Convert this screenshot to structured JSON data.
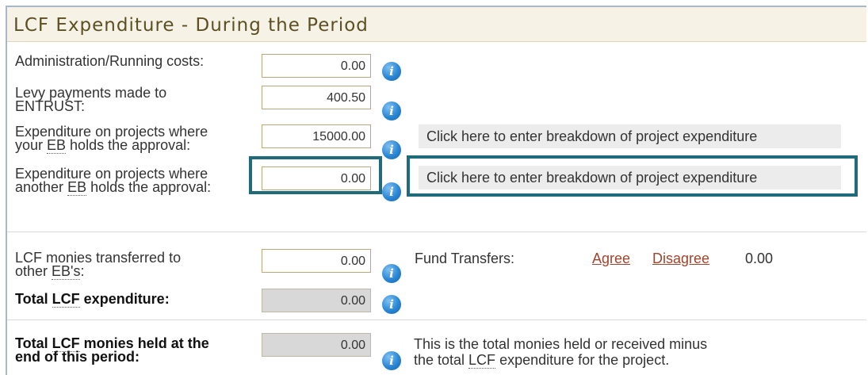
{
  "section": {
    "title": "LCF Expenditure - During the Period"
  },
  "rows": [
    {
      "label_1": "Administration/Running costs:",
      "value": "0.00"
    },
    {
      "label_1": "Levy payments made to",
      "label_2": "ENTRUST:",
      "value": "400.50"
    },
    {
      "label_1": "Expenditure on projects where",
      "label_2a": "your ",
      "label_2b": "EB",
      "label_2c": " holds the approval:",
      "value": "15000.00",
      "button": "Click here to enter breakdown of project expenditure"
    },
    {
      "label_1": "Expenditure on projects where",
      "label_2a": "another ",
      "label_2b": "EB",
      "label_2c": " holds the approval:",
      "value": "0.00",
      "button": "Click here to enter breakdown of project expenditure"
    },
    {
      "label_1": "LCF monies transferred to",
      "label_2a": "other ",
      "label_2b": "EB's",
      "label_2c": ":",
      "value": "0.00"
    },
    {
      "label_1a": "Total ",
      "label_1b": "LCF",
      "label_1c": " expenditure:",
      "value": "0.00"
    },
    {
      "label_1a": "Total ",
      "label_1b": "LCF",
      "label_1c": " monies held at the",
      "label_2": "end of this period:",
      "value": "0.00"
    }
  ],
  "fund_transfers": {
    "label": "Fund Transfers:",
    "agree": "Agree",
    "disagree": "Disagree",
    "amount": "0.00"
  },
  "total_note": {
    "line_1": "This is the total monies held or received minus",
    "line_2a": "the total ",
    "line_2b": "LCF",
    "line_2c": " expenditure for the project."
  },
  "icons": {
    "info": "i"
  }
}
